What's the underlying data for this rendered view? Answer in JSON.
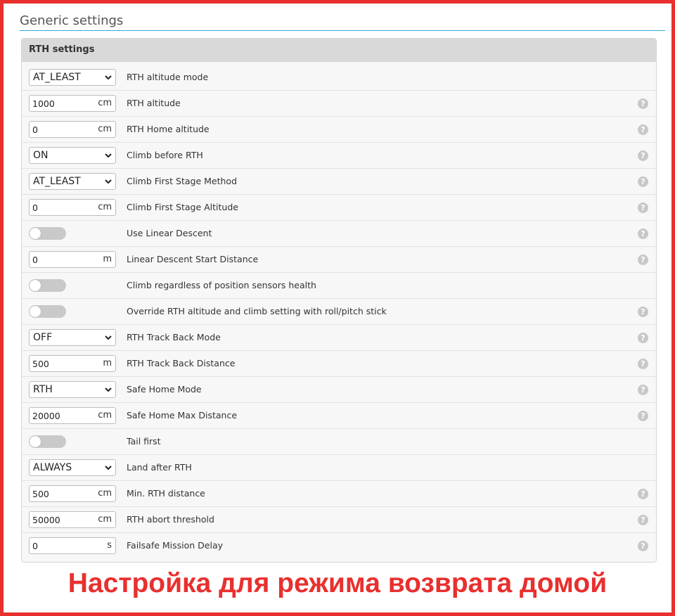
{
  "section": {
    "title": "Generic settings"
  },
  "panel": {
    "title": "RTH settings"
  },
  "help_icon": {
    "glyph": "?",
    "icon": "help-icon"
  },
  "rows": [
    {
      "kind": "select",
      "value": "AT_LEAST",
      "label": "RTH altitude mode",
      "help": false
    },
    {
      "kind": "number",
      "value": "1000",
      "unit": "cm",
      "label": "RTH altitude",
      "help": true
    },
    {
      "kind": "number",
      "value": "0",
      "unit": "cm",
      "label": "RTH Home altitude",
      "help": true
    },
    {
      "kind": "select",
      "value": "ON",
      "label": "Climb before RTH",
      "help": true
    },
    {
      "kind": "select",
      "value": "AT_LEAST",
      "label": "Climb First Stage Method",
      "help": true
    },
    {
      "kind": "number",
      "value": "0",
      "unit": "cm",
      "label": "Climb First Stage Altitude",
      "help": true
    },
    {
      "kind": "toggle",
      "checked": false,
      "label": "Use Linear Descent",
      "help": true
    },
    {
      "kind": "number",
      "value": "0",
      "unit": "m",
      "label": "Linear Descent Start Distance",
      "help": true
    },
    {
      "kind": "toggle",
      "checked": false,
      "label": "Climb regardless of position sensors health",
      "help": false
    },
    {
      "kind": "toggle",
      "checked": false,
      "label": "Override RTH altitude and climb setting with roll/pitch stick",
      "help": true
    },
    {
      "kind": "select",
      "value": "OFF",
      "label": "RTH Track Back Mode",
      "help": true
    },
    {
      "kind": "number",
      "value": "500",
      "unit": "m",
      "label": "RTH Track Back Distance",
      "help": true
    },
    {
      "kind": "select",
      "value": "RTH",
      "label": "Safe Home Mode",
      "help": true
    },
    {
      "kind": "number",
      "value": "20000",
      "unit": "cm",
      "label": "Safe Home Max Distance",
      "help": true
    },
    {
      "kind": "toggle",
      "checked": false,
      "label": "Tail first",
      "help": false
    },
    {
      "kind": "select",
      "value": "ALWAYS",
      "label": "Land after RTH",
      "help": false
    },
    {
      "kind": "number",
      "value": "500",
      "unit": "cm",
      "label": "Min. RTH distance",
      "help": true
    },
    {
      "kind": "number",
      "value": "50000",
      "unit": "cm",
      "label": "RTH abort threshold",
      "help": true
    },
    {
      "kind": "number",
      "value": "0",
      "unit": "s",
      "label": "Failsafe Mission Delay",
      "help": true
    }
  ],
  "caption": "Настройка для режима возврата домой",
  "colors": {
    "frame": "#e8302f",
    "accent_line": "#37a8db",
    "caption": "#e8302f"
  }
}
